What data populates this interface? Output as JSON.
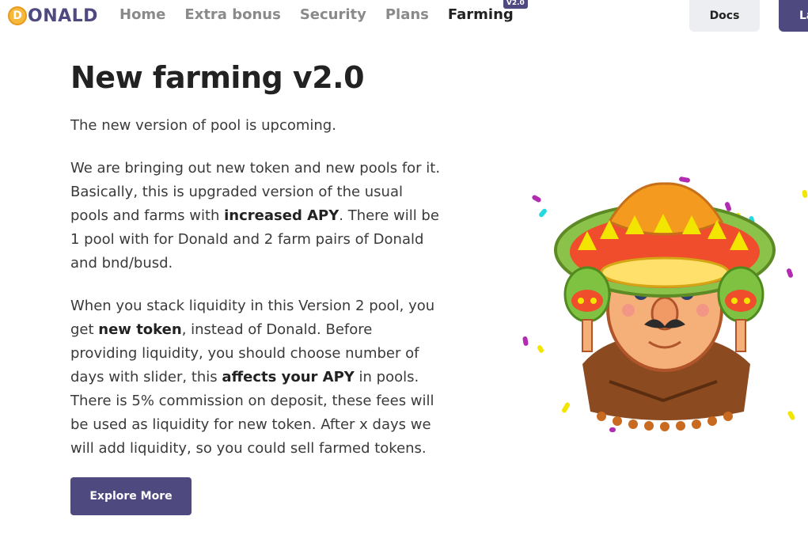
{
  "brand": {
    "coin_letter": "D",
    "name": "ONALD"
  },
  "nav": {
    "items": [
      {
        "label": "Home"
      },
      {
        "label": "Extra bonus"
      },
      {
        "label": "Security"
      },
      {
        "label": "Plans"
      },
      {
        "label": "Farming",
        "badge": "V2.0",
        "active": true
      }
    ]
  },
  "header_buttons": {
    "docs": "Docs",
    "launch": "La"
  },
  "main": {
    "title": "New farming v2.0",
    "intro": "The new version of pool is upcoming.",
    "para2": {
      "before": "We are bringing out new token and new pools for it. Basically, this is upgraded version of the usual pools and farms with ",
      "bold": "increased APY",
      "after": ". There will be 1 pool with for Donald and 2 farm pairs of Donald and bnd/busd."
    },
    "para3": {
      "t1": "When you stack liquidity in this Version 2 pool, you get ",
      "b1": "new token",
      "t2": ", instead of Donald. Before providing liquidity, you should choose number of days with slider, this ",
      "b2": "affects your APY",
      "t3": " in pools. There is 5% commission on deposit, these fees will be used as liquidity for new token. After x days we will add liquidity, so you could sell farmed tokens."
    },
    "explore_button": "Explore More"
  },
  "illustration": {
    "icon": "mascot-sombrero-maracas",
    "colors": {
      "brand": "#4e4a80",
      "coin": "#f7b93a"
    }
  }
}
